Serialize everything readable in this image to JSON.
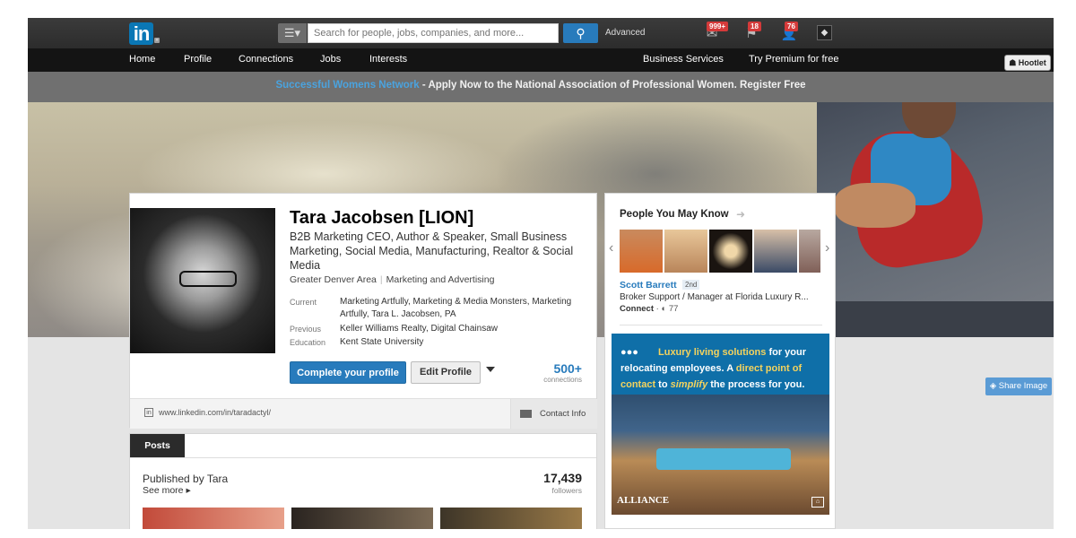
{
  "header": {
    "logo_text": "in",
    "search_placeholder": "Search for people, jobs, companies, and more...",
    "advanced_label": "Advanced",
    "badges": {
      "messages": "999+",
      "notifications": "18",
      "add_connections": "76"
    }
  },
  "nav": {
    "items": [
      "Home",
      "Profile",
      "Connections",
      "Jobs",
      "Interests"
    ],
    "right": [
      "Business Services",
      "Try Premium for free"
    ]
  },
  "hootlet": "Hootlet",
  "announcement": {
    "highlight": "Successful Womens Network",
    "text": " - Apply Now to the National Association of Professional Women. Register Free"
  },
  "profile": {
    "name": "Tara Jacobsen [LION]",
    "headline": "B2B Marketing CEO, Author & Speaker, Small Business Marketing, Social Media, Manufacturing, Realtor & Social Media",
    "location": "Greater Denver Area",
    "industry": "Marketing and Advertising",
    "current_label": "Current",
    "current_value": "Marketing Artfully, Marketing & Media Monsters, Marketing Artfully, Tara L. Jacobsen, PA",
    "previous_label": "Previous",
    "previous_value": "Keller Williams Realty, Digital Chainsaw",
    "education_label": "Education",
    "education_value": "Kent State University",
    "complete_button": "Complete your profile",
    "edit_button": "Edit Profile",
    "connections_count": "500+",
    "connections_label": "connections",
    "url": "www.linkedin.com/in/taradactyl/",
    "contact_info": "Contact Info"
  },
  "posts": {
    "tab": "Posts",
    "published_by": "Published by Tara",
    "see_more": "See more ▸",
    "followers_count": "17,439",
    "followers_label": "followers"
  },
  "pymk": {
    "title": "People You May Know",
    "person_name": "Scott Barrett",
    "degree": "2nd",
    "person_title": "Broker Support / Manager at Florida Luxury R...",
    "connect_label": "Connect",
    "shared_count": "77"
  },
  "ad": {
    "line1_a": "Luxury living solutions",
    "line1_b": " for your",
    "line2_a": "relocating employees. A ",
    "line2_b": "direct point of",
    "line3_a": "contact",
    "line3_b": " to ",
    "line3_c": "simplify",
    "line3_d": " the process for you.",
    "brand": "ALLIANCE"
  },
  "share_image": "Share Image",
  "colors": {
    "brand_blue": "#287bbc",
    "linkedin_blue": "#0a77b5",
    "badge_red": "#d53a3a"
  }
}
